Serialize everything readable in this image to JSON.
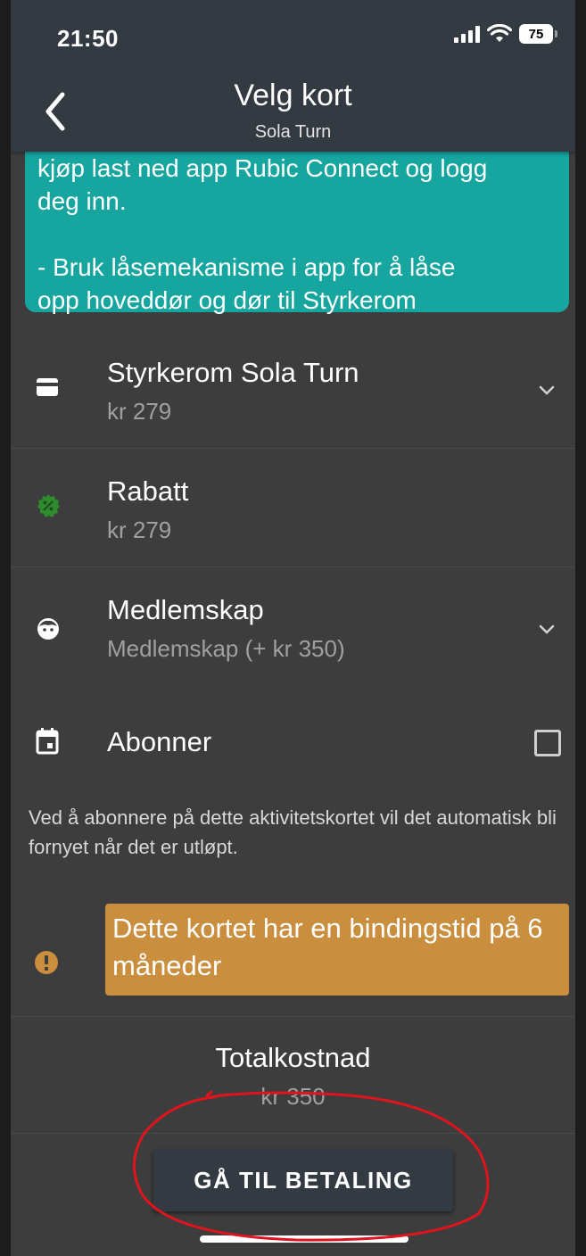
{
  "status_bar": {
    "time": "21:50",
    "battery": "75"
  },
  "header": {
    "title": "Velg kort",
    "subtitle": "Sola Turn"
  },
  "info_box": {
    "lines": [
      "kjøp last ned app Rubic Connect og logg",
      "deg inn.",
      "- Bruk låsemekanisme i app for å låse",
      "opp hoveddør og dør til Styrkerom"
    ],
    "color": "#16a59f"
  },
  "card": {
    "title": "Styrkerom Sola Turn",
    "price": "kr 279",
    "icon": "credit-card-icon"
  },
  "discount": {
    "title": "Rabatt",
    "price": "kr 279",
    "icon": "discount-badge-icon",
    "color": "#2e8b2e"
  },
  "membership": {
    "title": "Medlemskap",
    "value": "Medlemskap (+ kr 350)",
    "icon": "face-icon"
  },
  "subscribe": {
    "label": "Abonner",
    "checked": false,
    "icon": "calendar-icon"
  },
  "subscribe_note": "Ved å abonnere på dette aktivitetskortet vil det automatisk bli fornyet når det er utløpt.",
  "warning": {
    "text": "Dette kortet har en bindingstid på 6 måneder",
    "color": "#c98e3e",
    "icon": "exclamation-icon"
  },
  "total": {
    "label": "Totalkostnad",
    "value": "kr 350"
  },
  "pay_button": {
    "label": "GÅ TIL BETALING"
  },
  "colors": {
    "background": "#3d3d3d",
    "header": "#333a41",
    "annotation": "#e0141e"
  }
}
